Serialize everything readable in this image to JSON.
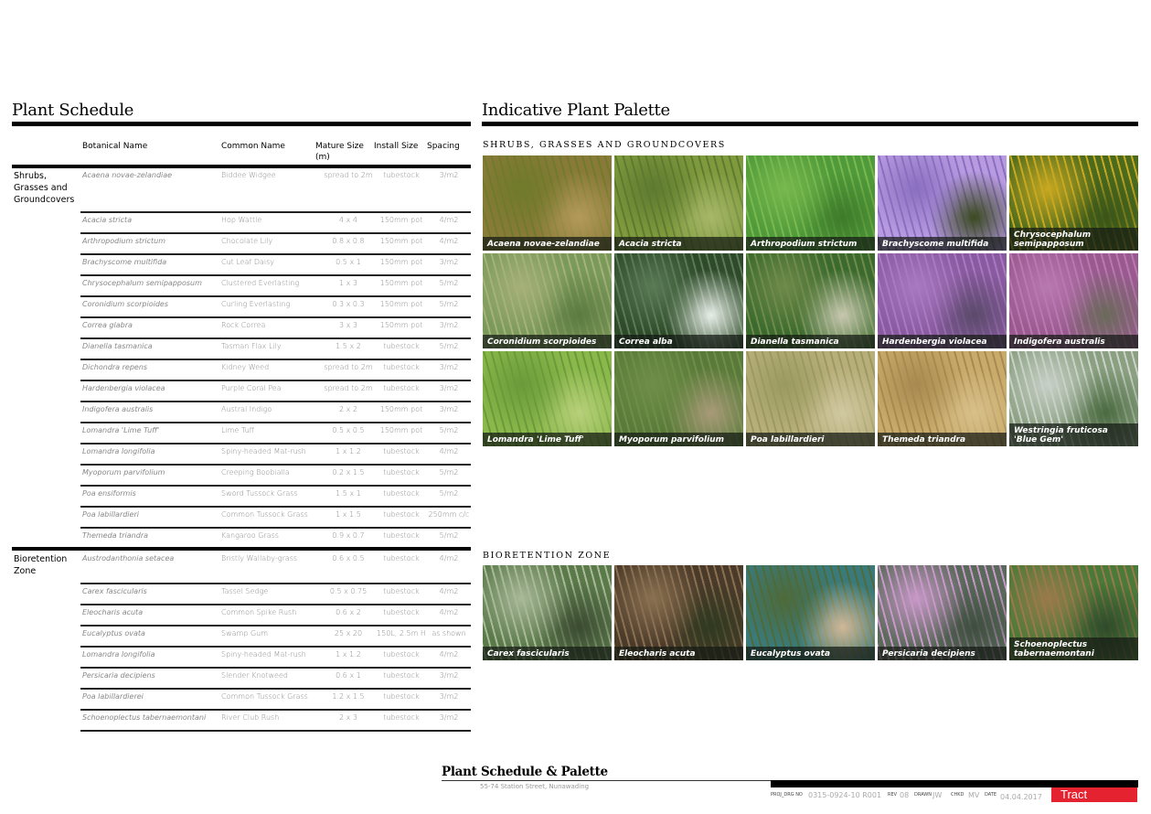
{
  "schedule": {
    "title": "Plant Schedule",
    "headers": {
      "botanical": "Botanical Name",
      "common": "Common Name",
      "mature": "Mature Size (m)",
      "install": "Install Size",
      "spacing": "Spacing"
    },
    "groups": [
      {
        "category": "Shrubs, Grasses and Groundcovers",
        "rows": [
          {
            "botanical": "Acaena novae-zelandiae",
            "common": "Biddee Widgee",
            "mature": "spread to 2m",
            "install": "tubestock",
            "spacing": "3/m2"
          },
          {
            "botanical": "Acacia stricta",
            "common": "Hop Wattle",
            "mature": "4 x 4",
            "install": "150mm pot",
            "spacing": "4/m2"
          },
          {
            "botanical": "Arthropodium strictum",
            "common": "Chocolate Lily",
            "mature": "0.8 x 0.8",
            "install": "150mm pot",
            "spacing": "4/m2"
          },
          {
            "botanical": "Brachyscome multifida",
            "common": "Cut Leaf Daisy",
            "mature": "0.5 x 1",
            "install": "150mm pot",
            "spacing": "3/m2"
          },
          {
            "botanical": "Chrysocephalum semipapposum",
            "common": "Clustered Everlasting",
            "mature": "1 x 3",
            "install": "150mm pot",
            "spacing": "5/m2"
          },
          {
            "botanical": "Coronidium scorpioides",
            "common": "Curling Everlasting",
            "mature": "0.3 x 0.3",
            "install": "150mm pot",
            "spacing": "5/m2"
          },
          {
            "botanical": "Correa glabra",
            "common": "Rock Correa",
            "mature": "3 x 3",
            "install": "150mm pot",
            "spacing": "3/m2"
          },
          {
            "botanical": "Dianella tasmanica",
            "common": "Tasman Flax Lily",
            "mature": "1.5 x 2",
            "install": "tubestock",
            "spacing": "5/m2"
          },
          {
            "botanical": "Dichondra repens",
            "common": "Kidney Weed",
            "mature": "spread to 2m",
            "install": "tubestock",
            "spacing": "3/m2"
          },
          {
            "botanical": "Hardenbergia violacea",
            "common": "Purple Coral Pea",
            "mature": "spread to 2m",
            "install": "tubestock",
            "spacing": "3/m2"
          },
          {
            "botanical": "Indigofera australis",
            "common": "Austral Indigo",
            "mature": "2 x 2",
            "install": "150mm pot",
            "spacing": "3/m2"
          },
          {
            "botanical": "Lomandra 'Lime Tuff'",
            "common": "Lime Tuff",
            "mature": "0.5 x 0.5",
            "install": "150mm pot",
            "spacing": "5/m2"
          },
          {
            "botanical": "Lomandra longifolia",
            "common": "Spiny-headed Mat-rush",
            "mature": "1 x 1.2",
            "install": "tubestock",
            "spacing": "4/m2"
          },
          {
            "botanical": "Myoporum parvifolium",
            "common": "Creeping Boobialla",
            "mature": "0.2 x 1.5",
            "install": "tubestock",
            "spacing": "5/m2"
          },
          {
            "botanical": "Poa ensiformis",
            "common": "Sword Tussock Grass",
            "mature": "1.5 x 1",
            "install": "tubestock",
            "spacing": "5/m2"
          },
          {
            "botanical": "Poa labillardieri",
            "common": "Common Tussock Grass",
            "mature": "1 x 1.5",
            "install": "tubestock",
            "spacing": "250mm c/c"
          },
          {
            "botanical": "Themeda triandra",
            "common": "Kangaroo Grass",
            "mature": "0.9 x 0.7",
            "install": "tubestock",
            "spacing": "5/m2"
          }
        ]
      },
      {
        "category": "Bioretention Zone",
        "rows": [
          {
            "botanical": "Austrodanthonia setacea",
            "common": "Bristly Wallaby-grass",
            "mature": "0.6 x 0.5",
            "install": "tubestock",
            "spacing": "4/m2"
          },
          {
            "botanical": "Carex fascicularis",
            "common": "Tassel Sedge",
            "mature": "0.5 x 0.75",
            "install": "tubestock",
            "spacing": "4/m2"
          },
          {
            "botanical": "Eleocharis acuta",
            "common": "Common Spike Rush",
            "mature": "0.6 x 2",
            "install": "tubestock",
            "spacing": "4/m2"
          },
          {
            "botanical": "Eucalyptus ovata",
            "common": "Swamp Gum",
            "mature": "25 x 20",
            "install": "150L, 2.5m H",
            "spacing": "as shown"
          },
          {
            "botanical": "Lomandra longifolia",
            "common": "Spiny-headed Mat-rush",
            "mature": "1 x 1.2",
            "install": "tubestock",
            "spacing": "4/m2"
          },
          {
            "botanical": "Persicaria decipiens",
            "common": "Slender Knotweed",
            "mature": "0.6 x 1",
            "install": "tubestock",
            "spacing": "3/m2"
          },
          {
            "botanical": "Poa labillardierei",
            "common": "Common Tussock Grass",
            "mature": "1.2 x 1.5",
            "install": "tubestock",
            "spacing": "3/m2"
          },
          {
            "botanical": "Schoenoplectus tabernaemontani",
            "common": "River Club Rush",
            "mature": "2 x 3",
            "install": "tubestock",
            "spacing": "3/m2"
          }
        ]
      }
    ]
  },
  "palette": {
    "title": "Indicative Plant Palette",
    "sections": [
      {
        "title": "SHRUBS, GRASSES AND GROUNDCOVERS",
        "tiles": [
          {
            "caption": "Acaena novae-zelandiae",
            "colors": [
              "#8a7a3a",
              "#6f7a2a",
              "#b49a5a"
            ]
          },
          {
            "caption": "Acacia stricta",
            "colors": [
              "#7f9a3c",
              "#5d7a30",
              "#a8b86a"
            ]
          },
          {
            "caption": "Arthropodium strictum",
            "colors": [
              "#4f9a3a",
              "#78b84e",
              "#3e7a2a"
            ]
          },
          {
            "caption": "Brachyscome multifida",
            "colors": [
              "#b79ae0",
              "#8a6fc0",
              "#3a4a20"
            ]
          },
          {
            "caption": "Chrysocephalum semipapposum",
            "colors": [
              "#4a6a1e",
              "#c8a820",
              "#3a5518"
            ]
          },
          {
            "caption": "Coronidium scorpioides",
            "colors": [
              "#7a9a5a",
              "#a6b07a",
              "#5a7a40"
            ]
          },
          {
            "caption": "Correa alba",
            "colors": [
              "#2e4a2a",
              "#5a7a55",
              "#e8eee8"
            ]
          },
          {
            "caption": "Dianella tasmanica",
            "colors": [
              "#3a6a2e",
              "#6f8a4a",
              "#c8c8b0"
            ]
          },
          {
            "caption": "Hardenbergia violacea",
            "colors": [
              "#8a5aa0",
              "#a878c0",
              "#5a4a6a"
            ]
          },
          {
            "caption": "Indigofera australis",
            "colors": [
              "#9a5a90",
              "#b878b0",
              "#6a6a5a"
            ]
          },
          {
            "caption": "Lomandra 'Lime Tuff'",
            "colors": [
              "#8ab84a",
              "#6a9a3a",
              "#b8d07a"
            ]
          },
          {
            "caption": "Myoporum parvifolium",
            "colors": [
              "#5a7a3a",
              "#6e8e48",
              "#a89a78"
            ]
          },
          {
            "caption": "Poa labillardieri",
            "colors": [
              "#b8ae7a",
              "#9a9a60",
              "#d0c8a0"
            ]
          },
          {
            "caption": "Themeda triandra",
            "colors": [
              "#c8aa6a",
              "#a88a50",
              "#d8c08a"
            ]
          },
          {
            "caption": "Westringia fruticosa 'Blue Gem'",
            "colors": [
              "#8aa080",
              "#c8d0c8",
              "#4a6a40"
            ]
          }
        ]
      },
      {
        "title": "BIORETENTION ZONE",
        "tiles": [
          {
            "caption": "Carex fascicularis",
            "colors": [
              "#5a7a4a",
              "#a8b898",
              "#3a4a30"
            ]
          },
          {
            "caption": "Eleocharis acuta",
            "colors": [
              "#4a3a2a",
              "#8a7050",
              "#2e3a20"
            ]
          },
          {
            "caption": "Eucalyptus ovata",
            "colors": [
              "#3a7a7a",
              "#4e6a3a",
              "#d0b898"
            ]
          },
          {
            "caption": "Persicaria decipiens",
            "colors": [
              "#5a6a5a",
              "#c898c8",
              "#3e4e3e"
            ]
          },
          {
            "caption": "Schoenoplectus tabernaemontani",
            "colors": [
              "#4a7a3a",
              "#9a7a4a",
              "#2e4a2a"
            ]
          }
        ]
      }
    ]
  },
  "footer": {
    "title": "Plant Schedule & Palette",
    "address": "55-74 Station Street, Nunawading",
    "proj_label": "PROJ_DRG NO",
    "proj_value": "0315-0924-10 R001",
    "rev_label": "REV",
    "rev_value": "08",
    "drawn_label": "DRAWN",
    "drawn_value": "JW",
    "chkd_label": "CHKD",
    "chkd_value": "MV",
    "date_label": "DATE",
    "date_value": "04.04.2017",
    "logo": "Tract",
    "logo_color": "#e52330"
  }
}
